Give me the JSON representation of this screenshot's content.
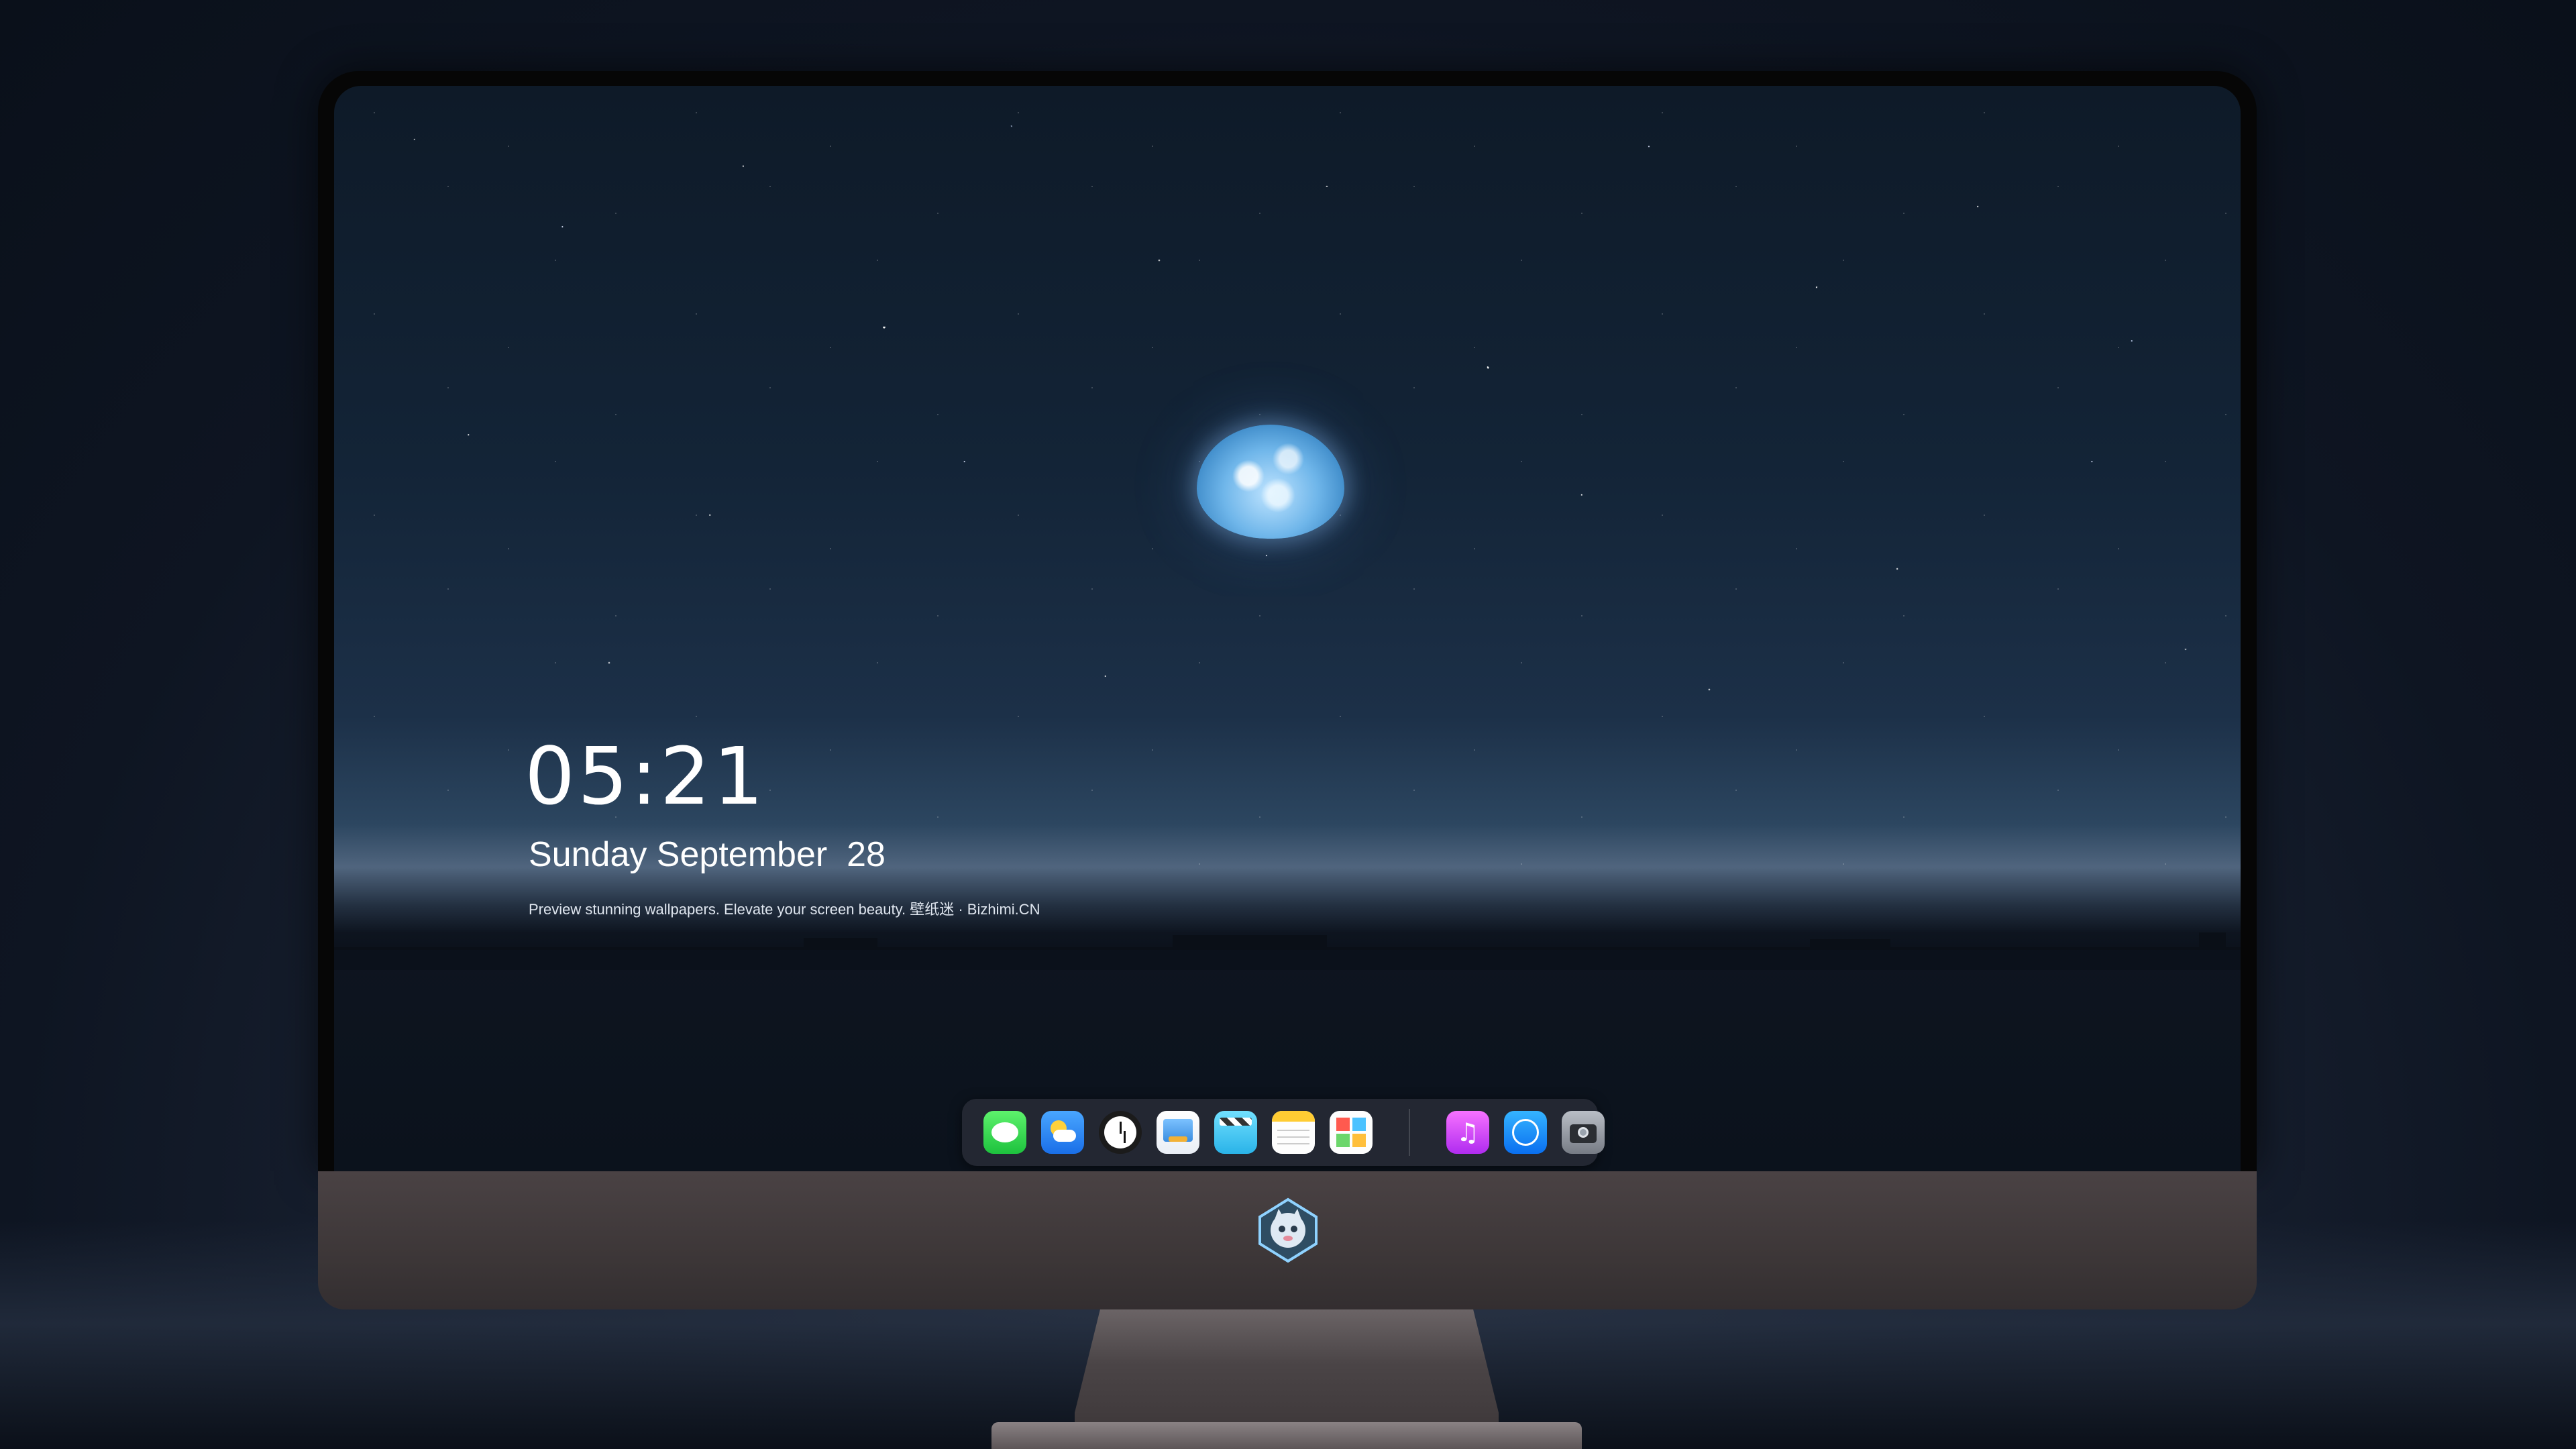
{
  "lock_screen": {
    "time": "05:21",
    "date": "Sunday September  28",
    "tagline": "Preview stunning wallpapers. Elevate your screen beauty. 壁纸迷 · Bizhimi.CN"
  },
  "dock": {
    "apps": [
      {
        "name": "messages-icon"
      },
      {
        "name": "weather-icon"
      },
      {
        "name": "clock-icon"
      },
      {
        "name": "preview-icon"
      },
      {
        "name": "clips-icon"
      },
      {
        "name": "notes-icon"
      },
      {
        "name": "calendar-icon"
      },
      {
        "name": "music-icon"
      },
      {
        "name": "app-store-icon"
      },
      {
        "name": "camera-icon"
      }
    ]
  },
  "monitor": {
    "logo": "mascot-logo"
  },
  "colors": {
    "sky_top": "#0e1a28",
    "horizon_glow": "#50657e",
    "chin": "#4a4244",
    "dock_bg": "#282c36"
  }
}
